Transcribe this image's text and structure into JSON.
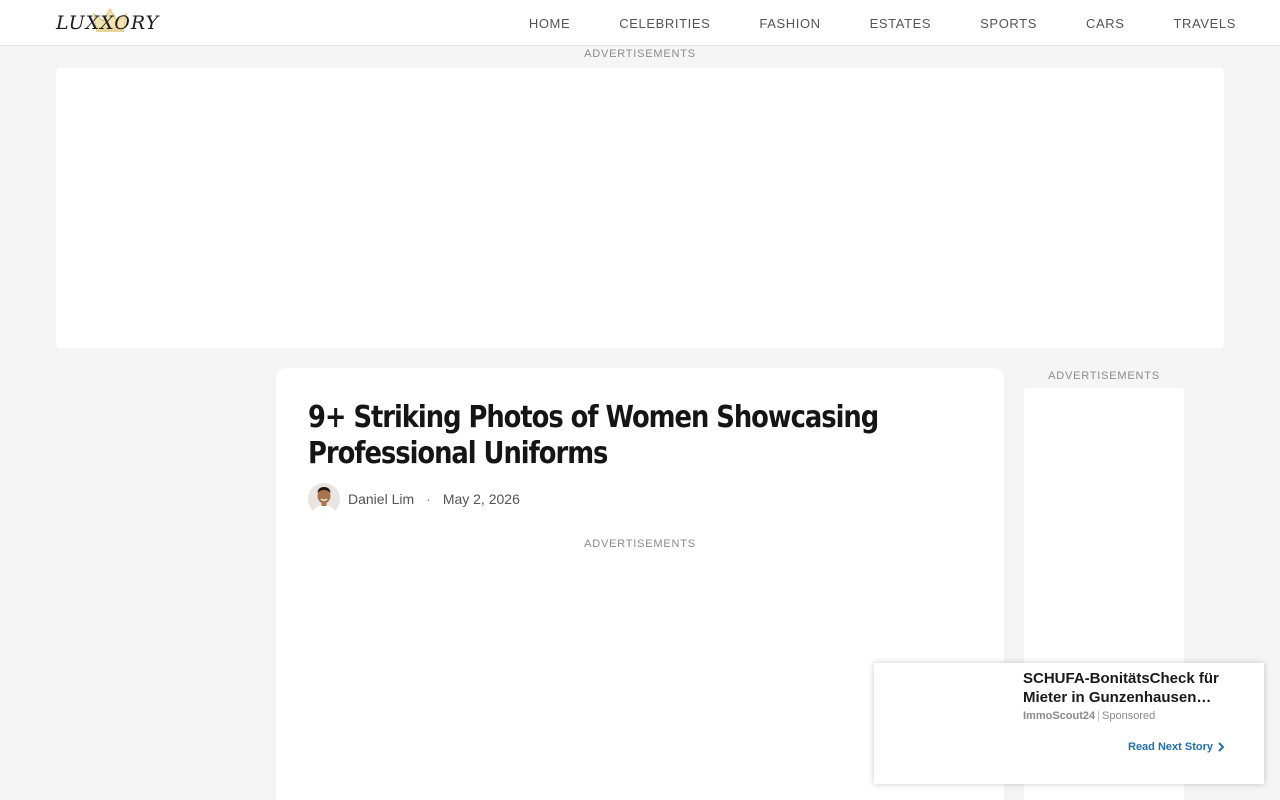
{
  "brand": {
    "logo_text": "LUXXORY"
  },
  "nav": {
    "items": [
      {
        "label": "HOME"
      },
      {
        "label": "CELEBRITIES"
      },
      {
        "label": "FASHION"
      },
      {
        "label": "ESTATES"
      },
      {
        "label": "SPORTS"
      },
      {
        "label": "CARS"
      },
      {
        "label": "TRAVELS"
      }
    ]
  },
  "ads": {
    "label": "ADVERTISEMENTS"
  },
  "article": {
    "title": "9+ Striking Photos of Women Showcasing Professional Uniforms",
    "author": "Daniel Lim",
    "separator": "·",
    "date": "May 2, 2026"
  },
  "sponsored": {
    "title": "SCHUFA-BonitätsCheck für Mieter in Gunzenhausen…",
    "source": "ImmoScout24",
    "divider": "|",
    "tag": "Sponsored",
    "cta": "Read Next Story",
    "cta_icon": "chevron-right-icon"
  },
  "colors": {
    "background": "#f5f5f5",
    "card": "#ffffff",
    "link_blue": "#1e6fb5"
  }
}
